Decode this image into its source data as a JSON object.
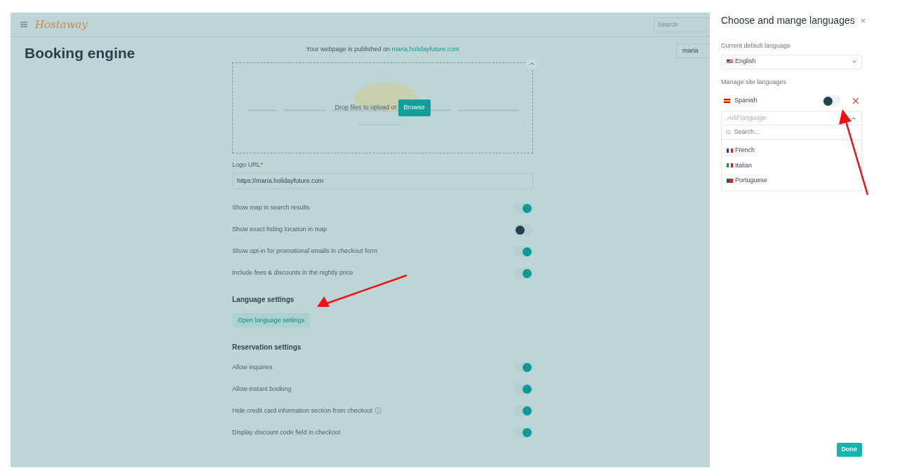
{
  "header": {
    "logo": "Hostaway",
    "search": {
      "placeholder": "Search"
    }
  },
  "page": {
    "title": "Booking engine",
    "published_text": "Your webpage is published on ",
    "published_link": "maria.holidayfuture.com",
    "user_field": "maria"
  },
  "upload": {
    "drop_text": "Drop files to upload or",
    "browse": "Browse"
  },
  "logo_url": {
    "label": "Logo URL",
    "required": "*",
    "value": "https://maria.holidayfuture.com"
  },
  "toggles": [
    {
      "label": "Show map in search results",
      "on": true
    },
    {
      "label": "Show exact listing location in map",
      "on": false
    },
    {
      "label": "Show opt-in for promotional emails in checkout form",
      "on": true
    },
    {
      "label": "Include fees & discounts in the nightly price",
      "on": true
    }
  ],
  "language_settings": {
    "heading": "Language settings",
    "button": "Open language settings"
  },
  "reservation_settings": {
    "heading": "Reservation settings",
    "toggles": [
      {
        "label": "Allow inquiries",
        "on": true,
        "info": false
      },
      {
        "label": "Allow instant booking",
        "on": true,
        "info": false
      },
      {
        "label": "Hide credit card information section from checkout",
        "on": true,
        "info": true
      },
      {
        "label": "Display discount code field in checkout",
        "on": true,
        "info": false
      }
    ]
  },
  "drawer": {
    "title": "Choose and mange languages",
    "close": "×",
    "default_label": "Current default language",
    "default_value": "English",
    "manage_label": "Manage site languages",
    "site_languages": [
      {
        "name": "Spanish",
        "on": false
      }
    ],
    "add": {
      "placeholder": "Add language",
      "expanded": true,
      "search_placeholder": "Search...",
      "options": [
        "French",
        "Italian",
        "Portuguese"
      ]
    },
    "done": "Done"
  }
}
